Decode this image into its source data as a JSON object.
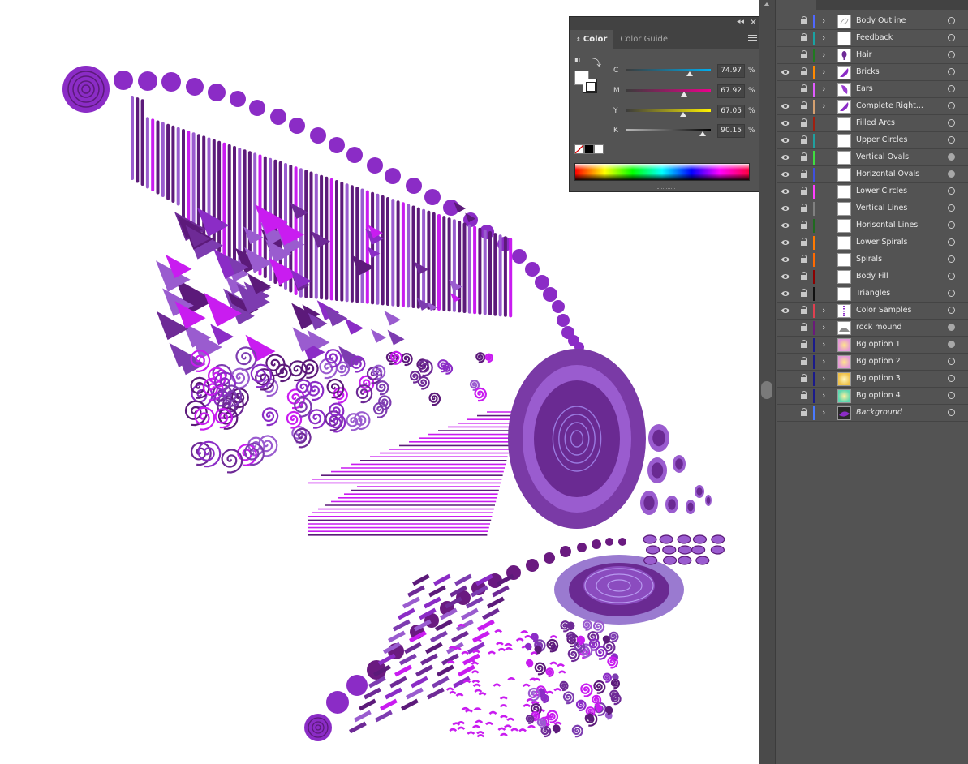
{
  "color_panel": {
    "tabs": [
      {
        "label": "Color",
        "active": true
      },
      {
        "label": "Color Guide",
        "active": false
      }
    ],
    "collapse_icon": "double-chevron-left-icon",
    "close_icon": "close-icon",
    "menu_icon": "hamburger-menu-icon",
    "sliders": [
      {
        "channel": "C",
        "value": "74.97",
        "fraction": 0.7497,
        "track": [
          "#3b3b3b",
          "#00aeef"
        ]
      },
      {
        "channel": "M",
        "value": "67.92",
        "fraction": 0.6792,
        "track": [
          "#3b3b3b",
          "#ec008c"
        ]
      },
      {
        "channel": "Y",
        "value": "67.05",
        "fraction": 0.6705,
        "track": [
          "#3b3b3b",
          "#fff200"
        ]
      },
      {
        "channel": "K",
        "value": "90.15",
        "fraction": 0.9015,
        "track": [
          "#b8b8b8",
          "#000000"
        ]
      }
    ],
    "percent_sign": "%",
    "quick_swatches": [
      "none",
      "#000000",
      "#ffffff"
    ]
  },
  "layers": [
    {
      "name": "Body Outline",
      "visible": false,
      "color": "#4f67ff",
      "expandable": true,
      "thumb": "outline",
      "target_filled": false,
      "italic": false
    },
    {
      "name": "Feedback",
      "visible": false,
      "color": "#1aa3a3",
      "expandable": true,
      "thumb": "blank",
      "target_filled": false,
      "italic": false
    },
    {
      "name": "Hair",
      "visible": false,
      "color": "#1f7a1f",
      "expandable": true,
      "thumb": "purple-drop",
      "target_filled": false,
      "italic": false
    },
    {
      "name": "Bricks",
      "visible": true,
      "color": "#ff8a00",
      "expandable": true,
      "thumb": "purple-wing",
      "target_filled": false,
      "italic": false
    },
    {
      "name": "Ears",
      "visible": false,
      "color": "#e05cff",
      "expandable": true,
      "thumb": "purple-ear",
      "target_filled": false,
      "italic": false
    },
    {
      "name": "Complete Right...",
      "visible": true,
      "color": "#d4a070",
      "expandable": true,
      "thumb": "purple-wing",
      "target_filled": false,
      "italic": false
    },
    {
      "name": "Filled Arcs",
      "visible": true,
      "color": "#a02010",
      "expandable": false,
      "thumb": "blank",
      "target_filled": false,
      "italic": false
    },
    {
      "name": "Upper Circles",
      "visible": true,
      "color": "#20a0a0",
      "expandable": false,
      "thumb": "blank",
      "target_filled": false,
      "italic": false
    },
    {
      "name": "Vertical Ovals",
      "visible": true,
      "color": "#40dd40",
      "expandable": false,
      "thumb": "blank",
      "target_filled": true,
      "italic": false
    },
    {
      "name": "Horizontal Ovals",
      "visible": true,
      "color": "#4050dd",
      "expandable": false,
      "thumb": "blank",
      "target_filled": true,
      "italic": false
    },
    {
      "name": "Lower Circles",
      "visible": true,
      "color": "#ff40ff",
      "expandable": false,
      "thumb": "blank",
      "target_filled": false,
      "italic": false
    },
    {
      "name": "Vertical Lines",
      "visible": true,
      "color": "#808080",
      "expandable": false,
      "thumb": "blank",
      "target_filled": false,
      "italic": false
    },
    {
      "name": "Horisontal Lines",
      "visible": true,
      "color": "#1f6a1f",
      "expandable": false,
      "thumb": "blank",
      "target_filled": false,
      "italic": false
    },
    {
      "name": "Lower Spirals",
      "visible": true,
      "color": "#ff7a00",
      "expandable": false,
      "thumb": "blank",
      "target_filled": false,
      "italic": false
    },
    {
      "name": "Spirals",
      "visible": true,
      "color": "#ff6a00",
      "expandable": false,
      "thumb": "blank",
      "target_filled": false,
      "italic": false
    },
    {
      "name": "Body Fill",
      "visible": true,
      "color": "#8b0000",
      "expandable": false,
      "thumb": "blank",
      "target_filled": false,
      "italic": false
    },
    {
      "name": "Triangles",
      "visible": true,
      "color": "#111111",
      "expandable": false,
      "thumb": "blank",
      "target_filled": false,
      "italic": false
    },
    {
      "name": "Color Samples",
      "visible": true,
      "color": "#e04050",
      "expandable": true,
      "thumb": "dots",
      "target_filled": false,
      "italic": false
    },
    {
      "name": "rock mound",
      "visible": false,
      "color": "#6a1a7a",
      "expandable": true,
      "thumb": "mound",
      "target_filled": true,
      "italic": false
    },
    {
      "name": "Bg option 1",
      "visible": false,
      "color": "#1a1a8a",
      "expandable": true,
      "thumb": "gradient-pink",
      "target_filled": true,
      "italic": false
    },
    {
      "name": "Bg option 2",
      "visible": false,
      "color": "#1a1a8a",
      "expandable": true,
      "thumb": "gradient-pink",
      "target_filled": false,
      "italic": false
    },
    {
      "name": "Bg option 3",
      "visible": false,
      "color": "#1a1a8a",
      "expandable": true,
      "thumb": "gradient-yellow",
      "target_filled": false,
      "italic": false
    },
    {
      "name": "Bg option 4",
      "visible": false,
      "color": "#1a1a8a",
      "expandable": true,
      "thumb": "gradient-green",
      "target_filled": false,
      "italic": false
    },
    {
      "name": "Background",
      "visible": false,
      "color": "#4a7aff",
      "expandable": true,
      "thumb": "dark-wing",
      "target_filled": false,
      "italic": true
    }
  ],
  "artwork": {
    "palette": [
      "#8b2cc6",
      "#5c1a7a",
      "#9a5ccf",
      "#c91cf0",
      "#6e2a96",
      "#7d3cb0"
    ]
  }
}
